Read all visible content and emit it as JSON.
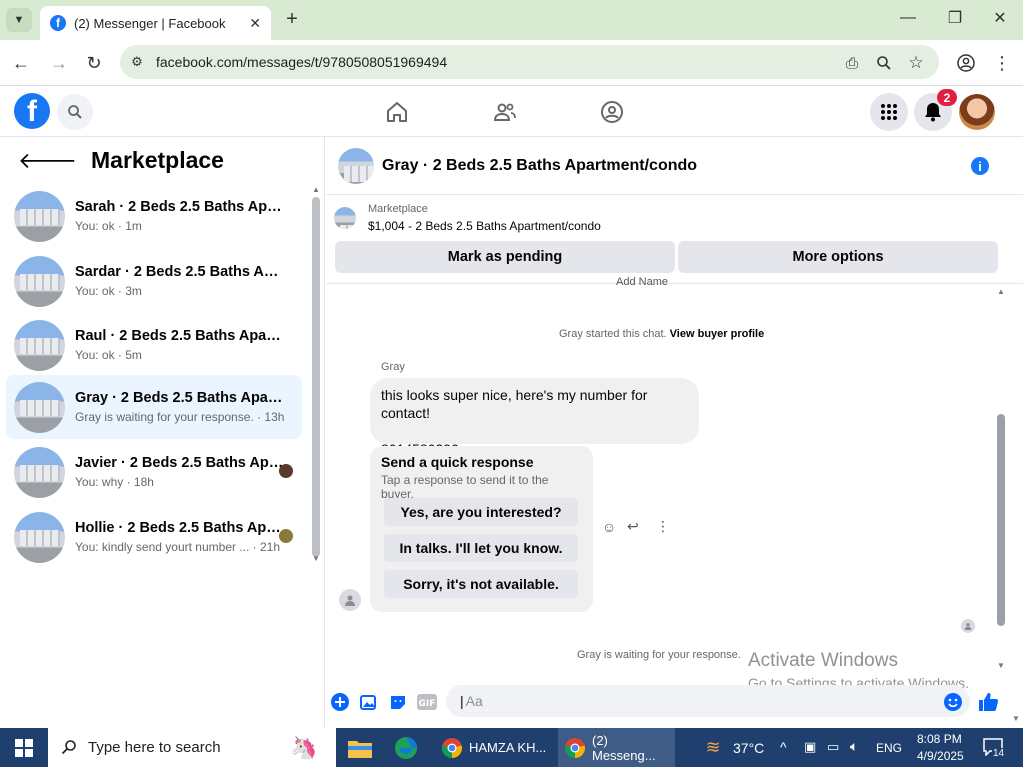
{
  "browser": {
    "tab_title": "(2) Messenger | Facebook",
    "url": "facebook.com/messages/t/9780508051969494"
  },
  "fb": {
    "notif_count": "2"
  },
  "marketplace": {
    "title": "Marketplace",
    "conversations": [
      {
        "name": "Sarah · 2 Beds 2.5 Baths Apartm...",
        "sub": "You: ok · 1m"
      },
      {
        "name": "Sardar · 2 Beds 2.5 Baths Apart...",
        "sub": "You: ok · 3m"
      },
      {
        "name": "Raul · 2 Beds 2.5 Baths Apartme...",
        "sub": "You: ok · 5m"
      },
      {
        "name": "Gray · 2 Beds 2.5 Baths Apartme...",
        "sub": "Gray is waiting for your response. · 13h"
      },
      {
        "name": "Javier · 2 Beds 2.5 Baths Apar...",
        "sub": "You: why · 18h"
      },
      {
        "name": "Hollie · 2 Beds 2.5 Baths Apar...",
        "sub": "You: kindly send yourt number ... · 21h"
      }
    ]
  },
  "chat": {
    "title": "Gray · 2 Beds 2.5 Baths Apartment/condo",
    "listing_label": "Marketplace",
    "listing_price": "$1,004 - 2 Beds 2.5 Baths Apartment/condo",
    "mark_pending": "Mark as pending",
    "more_options": "More options",
    "partial_top": "Add          Name",
    "started_text": "Gray started this chat.",
    "view_profile": "View buyer profile",
    "sender": "Gray",
    "message_line1": "this looks super nice, here's my number for contact!",
    "message_line2": "8014580390",
    "quick_title": "Send a quick response",
    "quick_sub": "Tap a response to send it to the buyer.",
    "quick_responses": [
      "Yes, are you interested?",
      "In talks. I'll let you know.",
      "Sorry, it's not available."
    ],
    "waiting": "Gray is waiting for your response.",
    "input_placeholder": "Aa"
  },
  "watermark": {
    "line1": "Activate Windows",
    "line2": "Go to Settings to activate Windows."
  },
  "taskbar": {
    "search_placeholder": "Type here to search",
    "app1": "HAMZA KH...",
    "app2": "(2) Messeng...",
    "weather": "37°C",
    "lang": "ENG",
    "time": "8:08 PM",
    "date": "4/9/2025",
    "notif": "14"
  }
}
